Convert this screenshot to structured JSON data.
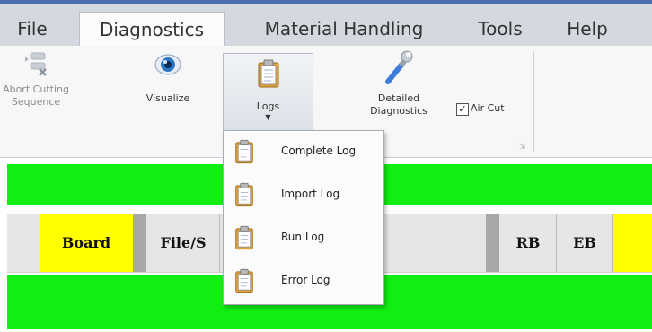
{
  "menu": [
    "File",
    "Diagnostics",
    "Material Handling",
    "Tools",
    "Help"
  ],
  "ribbon": {
    "abort_line1": "Abort Cutting",
    "abort_line2": "Sequence",
    "visualize": "Visualize",
    "logs": "Logs",
    "detailed_line1": "Detailed",
    "detailed_line2": "Diagnostics",
    "air_cut": "Air Cut",
    "air_cut_checked": true
  },
  "logs_menu": [
    {
      "label": "Complete Log",
      "icon": "clipboard-icon"
    },
    {
      "label": "Import Log",
      "icon": "clipboard-icon"
    },
    {
      "label": "Run Log",
      "icon": "clipboard-icon"
    },
    {
      "label": "Error Log",
      "icon": "clipboard-icon"
    }
  ],
  "grid": {
    "board": "Board",
    "file": "File/S",
    "rb": "RB",
    "eb": "EB"
  },
  "colors": {
    "status_green": "#11ee11",
    "highlight_yellow": "#ffff00"
  }
}
